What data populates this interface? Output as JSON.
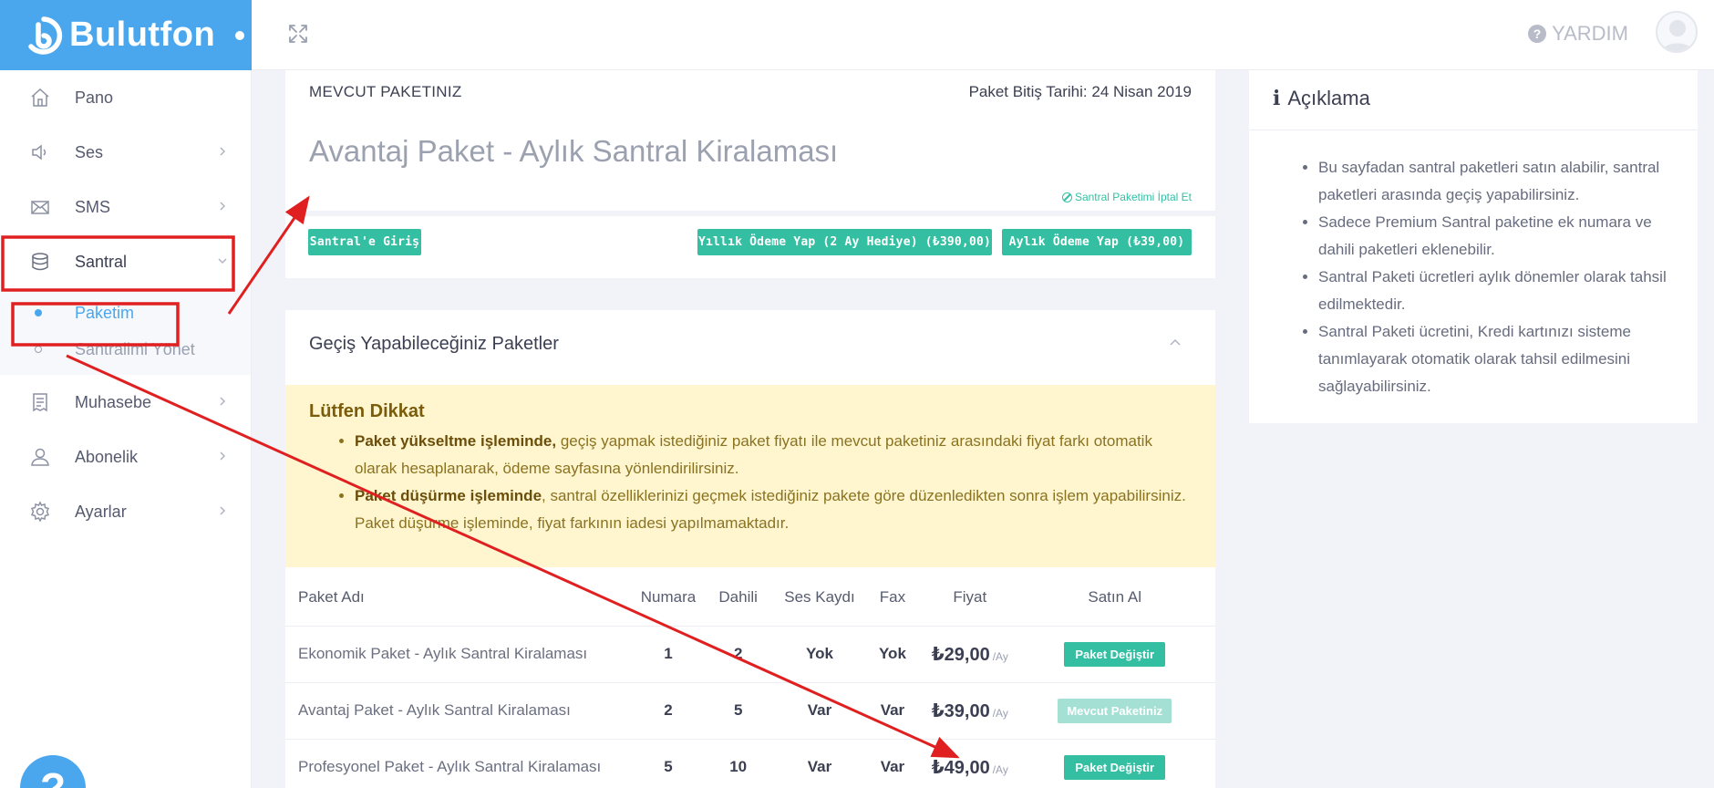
{
  "brand": {
    "name": "Bulutfon"
  },
  "header": {
    "help_label": "YARDIM"
  },
  "sidebar": {
    "items": [
      {
        "label": "Pano"
      },
      {
        "label": "Ses"
      },
      {
        "label": "SMS"
      },
      {
        "label": "Santral"
      },
      {
        "label": "Muhasebe"
      },
      {
        "label": "Abonelik"
      },
      {
        "label": "Ayarlar"
      }
    ],
    "sub_items": [
      {
        "label": "Paketim"
      },
      {
        "label": "Santralimi Yönet"
      }
    ]
  },
  "current": {
    "label": "MEVCUT PAKETINIZ",
    "end_date": "Paket Bitiş Tarihi: 24 Nisan 2019",
    "title": "Avantaj Paket - Aylık Santral Kiralaması",
    "cancel_link": "Santral Paketimi İptal Et",
    "btn_login": "Santral'e Giriş",
    "btn_yearly": "Yıllık Ödeme Yap (2 Ay Hediye) (₺390,00)",
    "btn_monthly": "Aylık Ödeme Yap (₺39,00)"
  },
  "switch": {
    "title": "Geçiş Yapabileceğiniz Paketler",
    "alert": {
      "title": "Lütfen Dikkat",
      "item1_bold": "Paket yükseltme işleminde,",
      "item1_text": " geçiş yapmak istediğiniz paket fiyatı ile mevcut paketiniz arasındaki fiyat farkı otomatik olarak hesaplanarak, ödeme sayfasına yönlendirilirsiniz.",
      "item2_bold": "Paket düşürme işleminde",
      "item2_text": ", santral özelliklerinizi geçmek istediğiniz pakete göre düzenledikten sonra işlem yapabilirsiniz. Paket düşürme işleminde, fiyat farkının iadesi yapılmamaktadır."
    },
    "headers": [
      "Paket Adı",
      "Numara",
      "Dahili",
      "Ses Kaydı",
      "Fax",
      "Fiyat",
      "Satın Al"
    ],
    "rows": [
      {
        "name": "Ekonomik Paket - Aylık Santral Kiralaması",
        "numara": "1",
        "dahili": "2",
        "ses": "Yok",
        "fax": "Yok",
        "price": "₺29,00",
        "per": "/Ay",
        "action": "Paket Değiştir"
      },
      {
        "name": "Avantaj Paket - Aylık Santral Kiralaması",
        "numara": "2",
        "dahili": "5",
        "ses": "Var",
        "fax": "Var",
        "price": "₺39,00",
        "per": "/Ay",
        "action": "Mevcut Paketiniz"
      },
      {
        "name": "Profesyonel Paket - Aylık Santral Kiralaması",
        "numara": "5",
        "dahili": "10",
        "ses": "Var",
        "fax": "Var",
        "price": "₺49,00",
        "per": "/Ay",
        "action": "Paket Değiştir"
      }
    ]
  },
  "explain": {
    "title": "Açıklama",
    "items": [
      "Bu sayfadan santral paketleri satın alabilir, santral paketleri arasında geçiş yapabilirsiniz.",
      "Sadece Premium Santral paketine ek numara ve dahili paketleri eklenebilir.",
      "Santral Paketi ücretleri aylık dönemler olarak tahsil edilmektedir.",
      "Santral Paketi ücretini, Kredi kartınızı sisteme tanımlayarak otomatik olarak tahsil edilmesini sağlayabilirsiniz."
    ]
  },
  "chat": {
    "label": "?"
  },
  "colors": {
    "brand": "#4aa7ee",
    "teal": "#34bfa3",
    "alert_bg": "#fff5cf",
    "annotation": "#e02020"
  }
}
